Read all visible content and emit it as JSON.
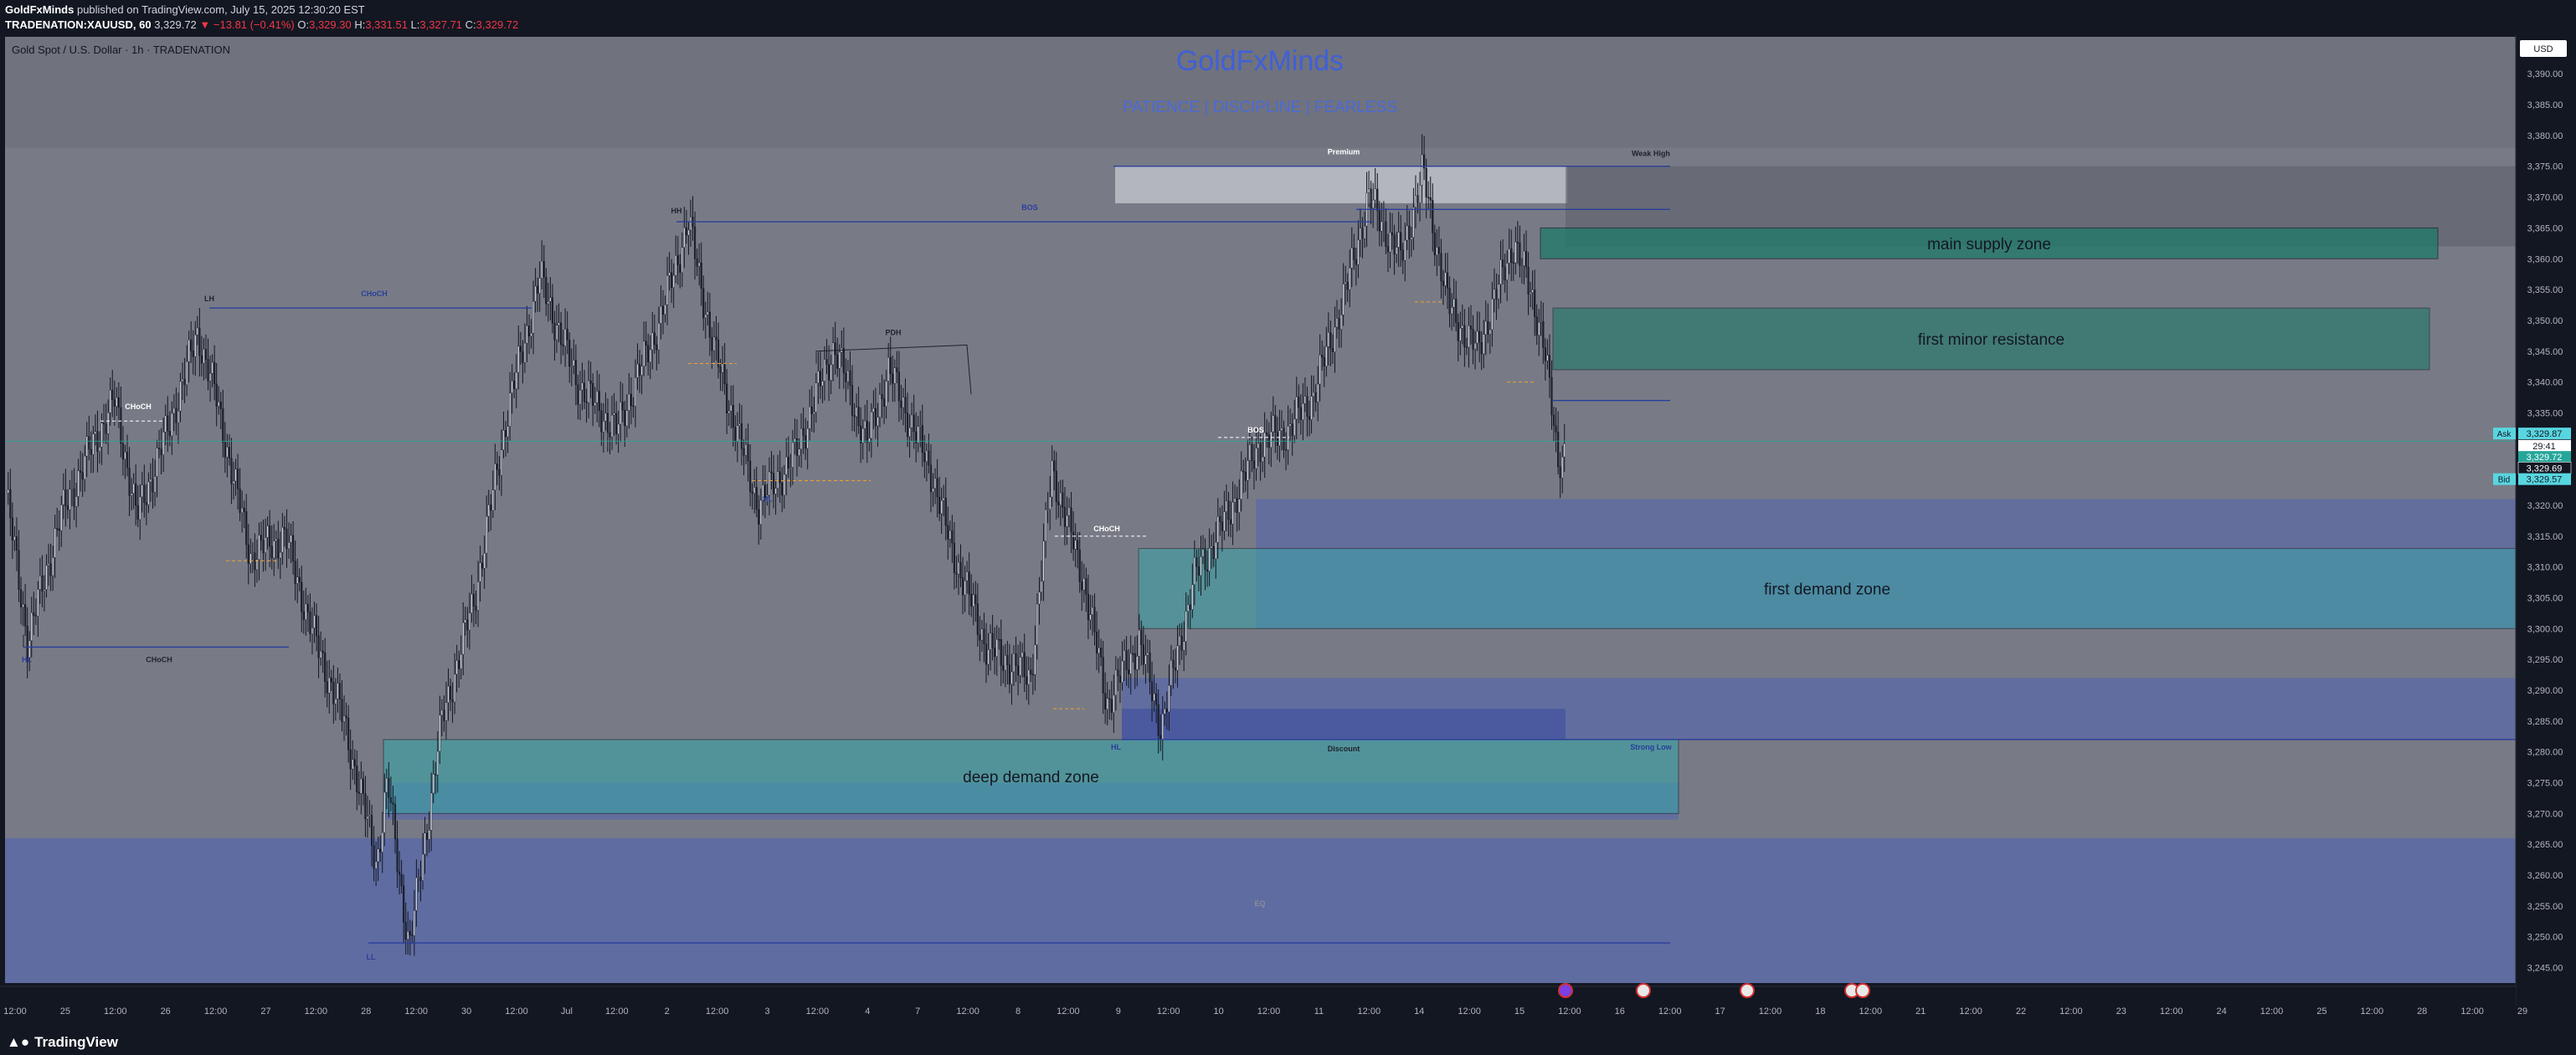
{
  "header": {
    "author": "GoldFxMinds",
    "published_text": "published on TradingView.com, July 15, 2025 12:30:20 EST",
    "symbol": "TRADENATION:XAUUSD, 60",
    "last": "3,329.72",
    "change": "▼ −13.81 (−0.41%)",
    "o_label": "O:",
    "o": "3,329.30",
    "h_label": "H:",
    "h": "3,331.51",
    "l_label": "L:",
    "l": "3,327.71",
    "c_label": "C:",
    "c": "3,329.72"
  },
  "legend": {
    "instrument": "Gold Spot / U.S. Dollar · 1h · TRADENATION",
    "currency": "USD"
  },
  "watermark": {
    "title": "GoldFxMinds",
    "tagline": "PATIENCE  |  DISCIPLINE  |  FEARLESS"
  },
  "price_tags": {
    "ask_label": "Ask",
    "ask": "3,329.87",
    "countdown": "29:41",
    "last": "3,329.72",
    "mid": "3,329.69",
    "bid_label": "Bid",
    "bid": "3,329.57"
  },
  "footer": {
    "brand": "TradingView"
  },
  "colors": {
    "background": "#787b86",
    "up": "#d1d4dc",
    "down": "#1e222d",
    "supply": "#1e7a6a",
    "demand": "#3aa3a8",
    "deep_zone": "#4a60b8",
    "structure_line": "#2a3e9c",
    "accent_text": "#3f60d8"
  },
  "chart_data": {
    "type": "candlestick",
    "title": "Gold Spot / U.S. Dollar · 1h · TRADENATION",
    "ylim": [
      3242.5,
      3396
    ],
    "y_ticks": [
      3390,
      3385,
      3380,
      3375,
      3370,
      3365,
      3360,
      3355,
      3350,
      3345,
      3340,
      3335,
      3330,
      3325,
      3320,
      3315,
      3310,
      3305,
      3300,
      3295,
      3290,
      3285,
      3280,
      3275,
      3270,
      3265,
      3260,
      3255,
      3250,
      3245
    ],
    "y_tick_labels": [
      "3,390.00",
      "3,385.00",
      "3,380.00",
      "3,375.00",
      "3,370.00",
      "3,365.00",
      "3,360.00",
      "3,355.00",
      "3,350.00",
      "3,345.00",
      "3,340.00",
      "3,335.00",
      "3,330.00",
      "3,325.00",
      "3,320.00",
      "3,315.00",
      "3,310.00",
      "3,305.00",
      "3,300.00",
      "3,295.00",
      "3,290.00",
      "3,285.00",
      "3,280.00",
      "3,275.00",
      "3,270.00",
      "3,265.00",
      "3,260.00",
      "3,255.00",
      "3,250.00",
      "3,245.00"
    ],
    "x_labels": [
      "12:00",
      "25",
      "12:00",
      "26",
      "12:00",
      "27",
      "12:00",
      "28",
      "12:00",
      "30",
      "12:00",
      "Jul",
      "12:00",
      "2",
      "12:00",
      "3",
      "12:00",
      "4",
      "7",
      "12:00",
      "8",
      "12:00",
      "9",
      "12:00",
      "10",
      "12:00",
      "11",
      "12:00",
      "14",
      "12:00",
      "15",
      "12:00",
      "16",
      "12:00",
      "17",
      "12:00",
      "18",
      "12:00",
      "21",
      "12:00",
      "22",
      "12:00",
      "23",
      "12:00",
      "24",
      "12:00",
      "25",
      "12:00",
      "28",
      "12:00",
      "29"
    ],
    "anchors": [
      [
        0,
        3322
      ],
      [
        10,
        3298
      ],
      [
        25,
        3318
      ],
      [
        40,
        3330
      ],
      [
        50,
        3337
      ],
      [
        60,
        3318
      ],
      [
        75,
        3333
      ],
      [
        88,
        3348
      ],
      [
        96,
        3338
      ],
      [
        112,
        3312
      ],
      [
        128,
        3315
      ],
      [
        140,
        3300
      ],
      [
        155,
        3285
      ],
      [
        170,
        3262
      ],
      [
        175,
        3275
      ],
      [
        185,
        3248
      ],
      [
        200,
        3285
      ],
      [
        215,
        3305
      ],
      [
        230,
        3335
      ],
      [
        245,
        3357
      ],
      [
        262,
        3340
      ],
      [
        280,
        3332
      ],
      [
        300,
        3350
      ],
      [
        313,
        3366
      ],
      [
        325,
        3345
      ],
      [
        345,
        3320
      ],
      [
        362,
        3328
      ],
      [
        380,
        3346
      ],
      [
        395,
        3330
      ],
      [
        405,
        3342
      ],
      [
        425,
        3325
      ],
      [
        433,
        3314
      ],
      [
        450,
        3297
      ],
      [
        470,
        3292
      ],
      [
        480,
        3326
      ],
      [
        495,
        3307
      ],
      [
        505,
        3288
      ],
      [
        520,
        3298
      ],
      [
        530,
        3284
      ],
      [
        545,
        3308
      ],
      [
        560,
        3318
      ],
      [
        575,
        3330
      ],
      [
        588,
        3332
      ],
      [
        600,
        3338
      ],
      [
        615,
        3355
      ],
      [
        625,
        3370
      ],
      [
        640,
        3360
      ],
      [
        650,
        3374
      ],
      [
        662,
        3352
      ],
      [
        675,
        3345
      ],
      [
        692,
        3363
      ],
      [
        705,
        3348
      ],
      [
        712,
        3327
      ],
      [
        716,
        3330
      ]
    ],
    "levels": {
      "hl_left": 3297,
      "lh": 3352,
      "hh": 3366,
      "ph": 3346,
      "bos_right": 3337,
      "choch_mid": 3315,
      "hl_mid": 3282,
      "low": 3249,
      "premium_top": 3375,
      "premium_low": 3368,
      "week_high": 3375
    },
    "zones": [
      {
        "name": "main supply zone",
        "y1": 3360,
        "y2": 3365
      },
      {
        "name": "first minor resistance",
        "y1": 3342,
        "y2": 3352
      },
      {
        "name": "first demand zone",
        "y1": 3300,
        "y2": 3313
      },
      {
        "name": "deep demand zone",
        "y1": 3270,
        "y2": 3282
      }
    ],
    "annotations": [
      "LH",
      "HH",
      "HL",
      "HL",
      "HL",
      "LL",
      "CHoCH",
      "CHoCH",
      "CHoCH",
      "CHoCH",
      "BOS",
      "BOS",
      "PDH",
      "Premium",
      "Discount",
      "Weak High",
      "Strong Low",
      "EQ"
    ]
  }
}
